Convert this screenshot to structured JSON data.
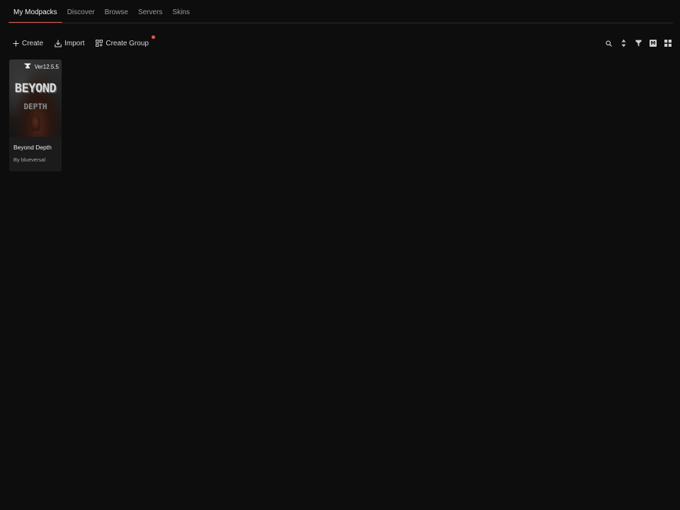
{
  "tabs": [
    {
      "label": "My Modpacks",
      "active": true
    },
    {
      "label": "Discover",
      "active": false
    },
    {
      "label": "Browse",
      "active": false
    },
    {
      "label": "Servers",
      "active": false
    },
    {
      "label": "Skins",
      "active": false
    }
  ],
  "toolbar": {
    "create_label": "Create",
    "import_label": "Import",
    "create_group_label": "Create Group",
    "create_group_has_notification": true
  },
  "right_tools": {
    "search_icon": "search-icon",
    "sort_icon": "sort-icon",
    "filter_icon": "filter-icon",
    "m_badge_label": "M",
    "grid_icon": "grid-view-icon"
  },
  "modpacks": [
    {
      "name": "Beyond Depth",
      "author": "By blueversal",
      "version": "Ver12.5.5",
      "loader_icon": "anvil-icon",
      "logo_line_1": "BEYOND",
      "logo_line_2": "DEPTH"
    }
  ],
  "colors": {
    "background": "#0d0d0d",
    "accent": "#e2574c",
    "card": "#1b1b1b",
    "text_primary": "#f0f0f0",
    "text_muted": "#9c9c9c"
  }
}
